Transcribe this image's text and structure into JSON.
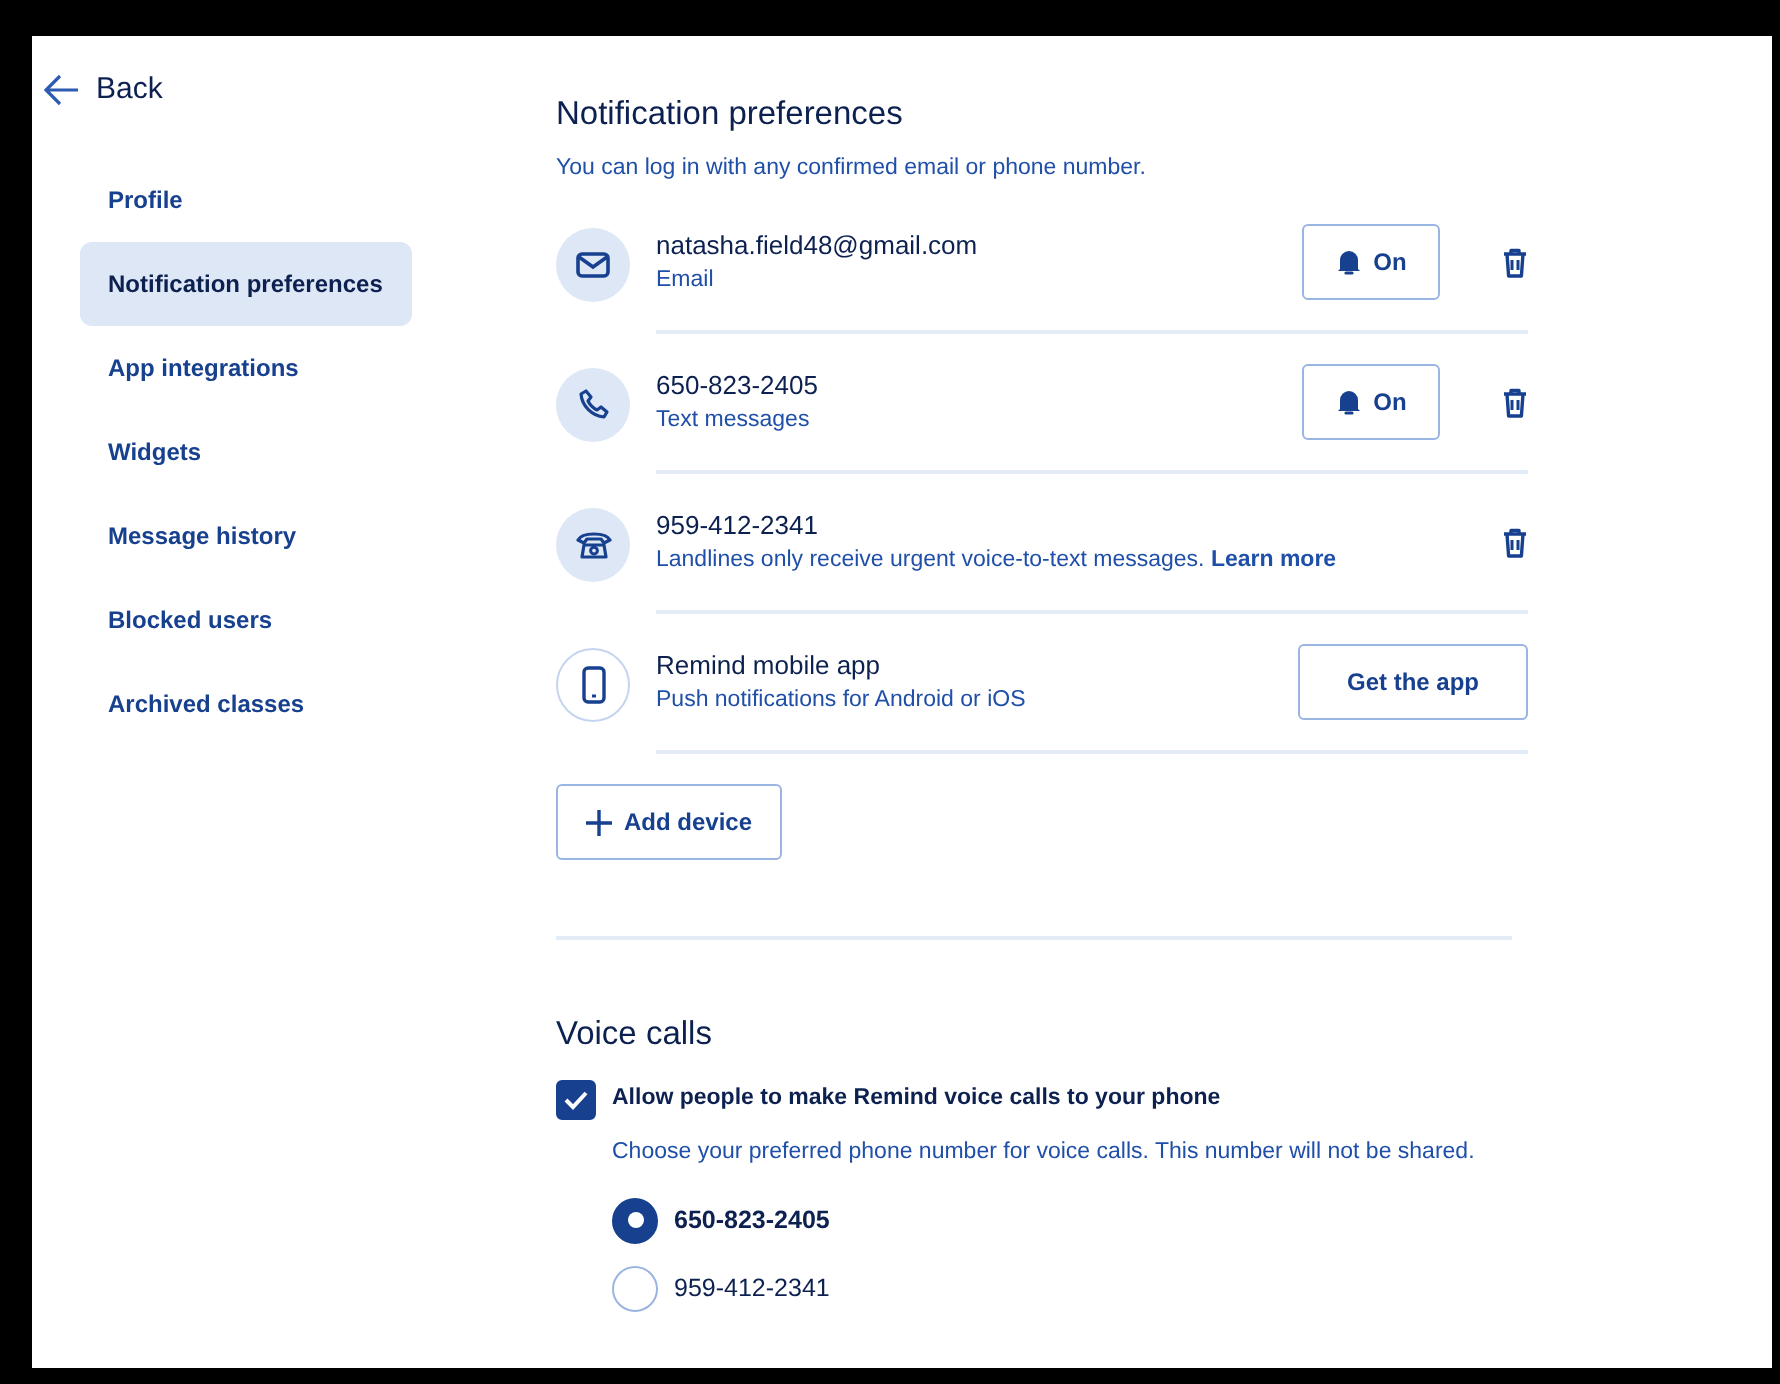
{
  "back": {
    "label": "Back"
  },
  "sidebar": {
    "items": [
      {
        "label": "Profile",
        "selected": false
      },
      {
        "label": "Notification preferences",
        "selected": true
      },
      {
        "label": "App integrations",
        "selected": false
      },
      {
        "label": "Widgets",
        "selected": false
      },
      {
        "label": "Message history",
        "selected": false
      },
      {
        "label": "Blocked users",
        "selected": false
      },
      {
        "label": "Archived classes",
        "selected": false
      }
    ]
  },
  "notifications": {
    "title": "Notification preferences",
    "subtitle": "You can log in with any confirmed email or phone number.",
    "devices": [
      {
        "kind": "email",
        "title": "natasha.field48@gmail.com",
        "subtitle": "Email",
        "action": {
          "kind": "notify",
          "label": "On"
        },
        "deletable": true
      },
      {
        "kind": "phone",
        "title": "650-823-2405",
        "subtitle": "Text messages",
        "action": {
          "kind": "notify",
          "label": "On"
        },
        "deletable": true
      },
      {
        "kind": "landline",
        "title": "959-412-2341",
        "subtitle": "Landlines only receive urgent voice-to-text messages.",
        "link": "Learn more",
        "deletable": true
      },
      {
        "kind": "app",
        "title": "Remind mobile app",
        "subtitle": "Push notifications for Android or iOS",
        "action": {
          "kind": "get",
          "label": "Get the app"
        },
        "deletable": false
      }
    ],
    "add_button": "Add device"
  },
  "voice_calls": {
    "title": "Voice calls",
    "allow": {
      "label": "Allow people to make Remind voice calls to your phone",
      "checked": true
    },
    "hint": "Choose your preferred phone number for voice calls. This number will not be shared.",
    "options": [
      {
        "label": "650-823-2405",
        "selected": true
      },
      {
        "label": "959-412-2341",
        "selected": false
      }
    ]
  }
}
